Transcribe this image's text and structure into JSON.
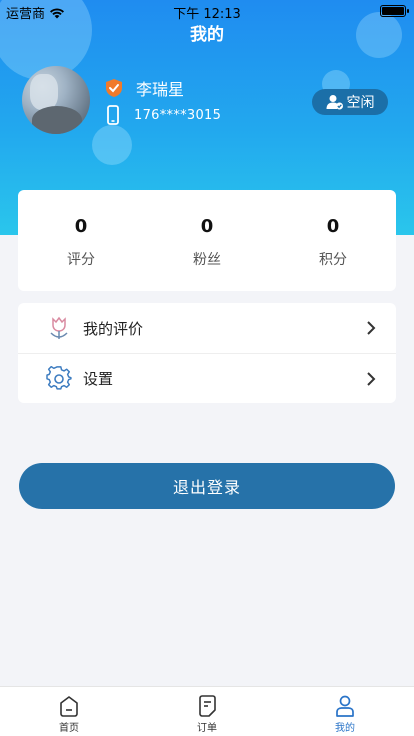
{
  "status_bar": {
    "carrier": "运营商",
    "time": "下午 12:13"
  },
  "page": {
    "title": "我的"
  },
  "profile": {
    "name": "李瑞星",
    "phone": "176****3015",
    "status": "空闲"
  },
  "stats": [
    {
      "value": "0",
      "label": "评分"
    },
    {
      "value": "0",
      "label": "粉丝"
    },
    {
      "value": "0",
      "label": "积分"
    }
  ],
  "menu": [
    {
      "label": "我的评价",
      "icon": "tulip-icon"
    },
    {
      "label": "设置",
      "icon": "gear-icon"
    }
  ],
  "logout": {
    "label": "退出登录"
  },
  "tabbar": [
    {
      "label": "首页",
      "icon": "home-icon"
    },
    {
      "label": "订单",
      "icon": "order-icon"
    },
    {
      "label": "我的",
      "icon": "person-icon",
      "active": true
    }
  ],
  "colors": {
    "header_top": "#1f8cf0",
    "header_bottom": "#2ac6ec",
    "button": "#2672a9",
    "status_pill": "#1b6fa8",
    "active_tab": "#2a74c8",
    "shield_orange": "#f07a2a"
  }
}
